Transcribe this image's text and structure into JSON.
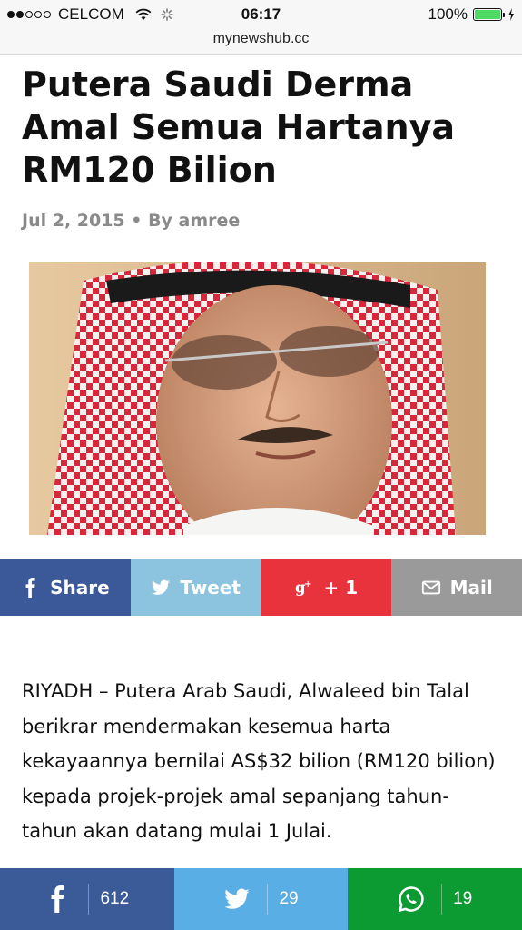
{
  "status_bar": {
    "carrier": "CELCOM",
    "time": "06:17",
    "battery_percent": "100%",
    "signal_bars_filled": 2,
    "signal_bars_total": 5,
    "battery_level": 1.0
  },
  "browser": {
    "url": "mynewshub.cc"
  },
  "article": {
    "title": "Putera Saudi Derma Amal Semua Hartanya RM120 Bilion",
    "date": "Jul 2, 2015",
    "separator": "•",
    "byline": "By amree",
    "body": "RIYADH – Putera Arab Saudi, Alwaleed bin Talal berikrar mendermakan kesemua harta kekayaannya bernilai AS$32 bilion (RM120 bilion) kepada projek-projek amal sepanjang tahun-tahun akan datang mulai 1 Julai."
  },
  "share_buttons": [
    {
      "label": "Share",
      "icon": "facebook-icon",
      "color": "#3b5998"
    },
    {
      "label": "Tweet",
      "icon": "twitter-icon",
      "color": "#8cc4e0"
    },
    {
      "label": "+ 1",
      "icon": "google-plus-icon",
      "color": "#e8323c"
    },
    {
      "label": "Mail",
      "icon": "mail-icon",
      "color": "#9a9a9a"
    }
  ],
  "footer_share": [
    {
      "icon": "facebook-icon",
      "count": "612",
      "color": "#3a5a98"
    },
    {
      "icon": "twitter-icon",
      "count": "29",
      "color": "#5aaee6"
    },
    {
      "icon": "whatsapp-icon",
      "count": "19",
      "color": "#0c9b32"
    }
  ],
  "colors": {
    "meta_text": "#8a8a8a",
    "battery_green": "#4cd964"
  }
}
